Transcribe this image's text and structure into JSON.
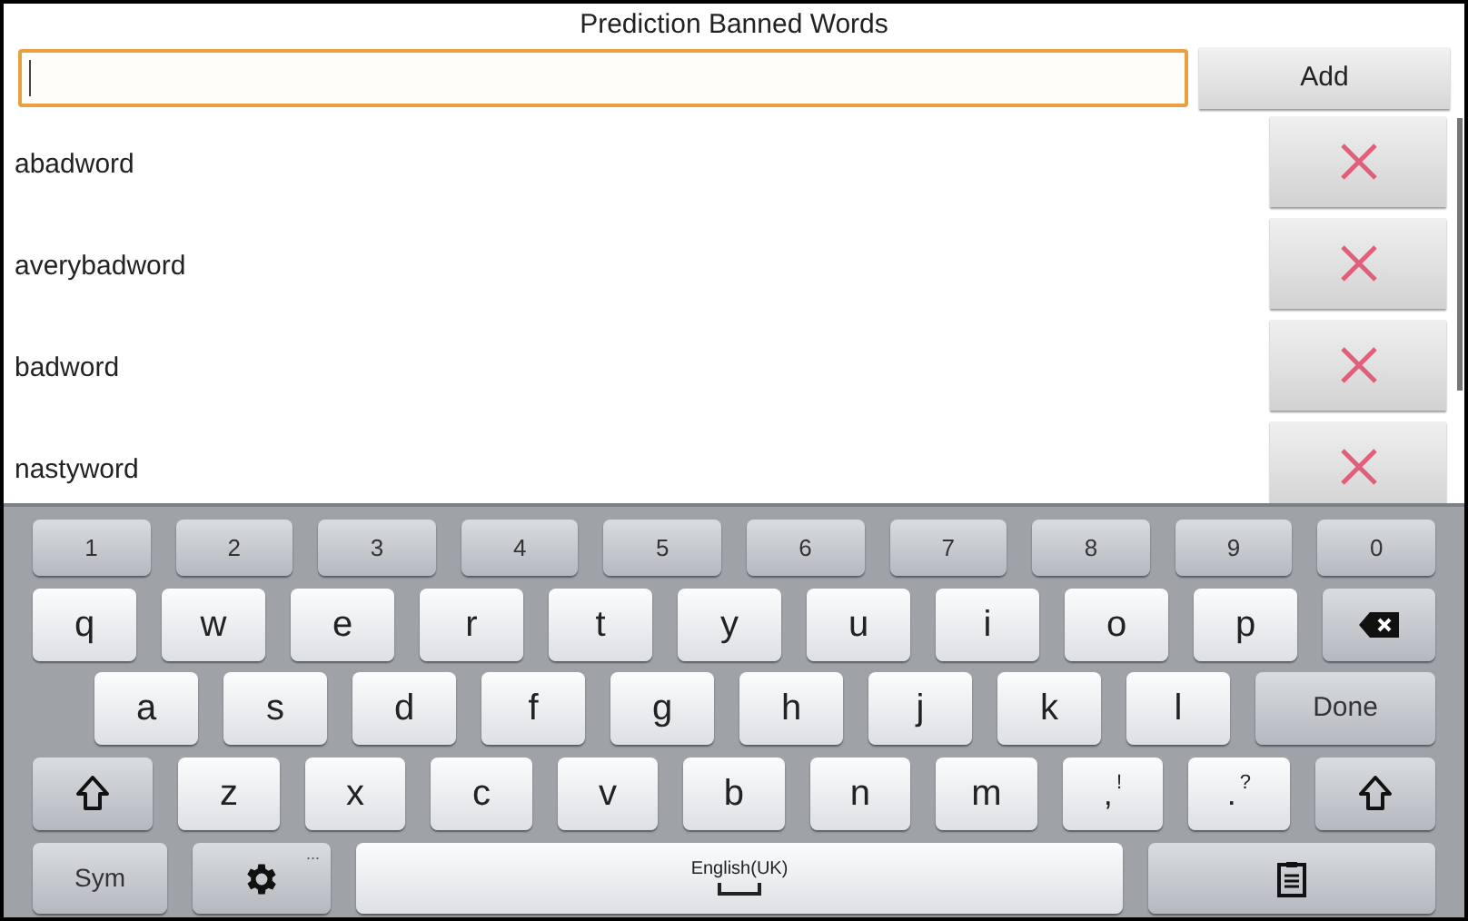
{
  "title": "Prediction Banned Words",
  "input": {
    "focused": true
  },
  "add_button": "Add",
  "words": [
    {
      "text": "abadword"
    },
    {
      "text": "averybadword"
    },
    {
      "text": "badword"
    },
    {
      "text": "nastyword"
    }
  ],
  "keyboard": {
    "rows": [
      [
        {
          "kind": "digit",
          "label": "1"
        },
        {
          "kind": "digit",
          "label": "2"
        },
        {
          "kind": "digit",
          "label": "3"
        },
        {
          "kind": "digit",
          "label": "4"
        },
        {
          "kind": "digit",
          "label": "5"
        },
        {
          "kind": "digit",
          "label": "6"
        },
        {
          "kind": "digit",
          "label": "7"
        },
        {
          "kind": "digit",
          "label": "8"
        },
        {
          "kind": "digit",
          "label": "9"
        },
        {
          "kind": "digit",
          "label": "0"
        }
      ],
      [
        {
          "kind": "char",
          "label": "q"
        },
        {
          "kind": "char",
          "label": "w"
        },
        {
          "kind": "char",
          "label": "e"
        },
        {
          "kind": "char",
          "label": "r"
        },
        {
          "kind": "char",
          "label": "t"
        },
        {
          "kind": "char",
          "label": "y"
        },
        {
          "kind": "char",
          "label": "u"
        },
        {
          "kind": "char",
          "label": "i"
        },
        {
          "kind": "char",
          "label": "o"
        },
        {
          "kind": "char",
          "label": "p"
        },
        {
          "kind": "backspace"
        }
      ],
      [
        {
          "kind": "char",
          "label": "a"
        },
        {
          "kind": "char",
          "label": "s"
        },
        {
          "kind": "char",
          "label": "d"
        },
        {
          "kind": "char",
          "label": "f"
        },
        {
          "kind": "char",
          "label": "g"
        },
        {
          "kind": "char",
          "label": "h"
        },
        {
          "kind": "char",
          "label": "j"
        },
        {
          "kind": "char",
          "label": "k"
        },
        {
          "kind": "char",
          "label": "l"
        },
        {
          "kind": "done",
          "label": "Done"
        }
      ],
      [
        {
          "kind": "shift"
        },
        {
          "kind": "char",
          "label": "z"
        },
        {
          "kind": "char",
          "label": "x"
        },
        {
          "kind": "char",
          "label": "c"
        },
        {
          "kind": "char",
          "label": "v"
        },
        {
          "kind": "char",
          "label": "b"
        },
        {
          "kind": "char",
          "label": "n"
        },
        {
          "kind": "char",
          "label": "m"
        },
        {
          "kind": "punct",
          "label": ",",
          "sub": "!"
        },
        {
          "kind": "punct",
          "label": ".",
          "sub": "?"
        },
        {
          "kind": "shift"
        }
      ],
      [
        {
          "kind": "sym",
          "label": "Sym"
        },
        {
          "kind": "settings",
          "sub": "..."
        },
        {
          "kind": "space",
          "label": "English(UK)"
        },
        {
          "kind": "clipboard"
        }
      ]
    ]
  }
}
